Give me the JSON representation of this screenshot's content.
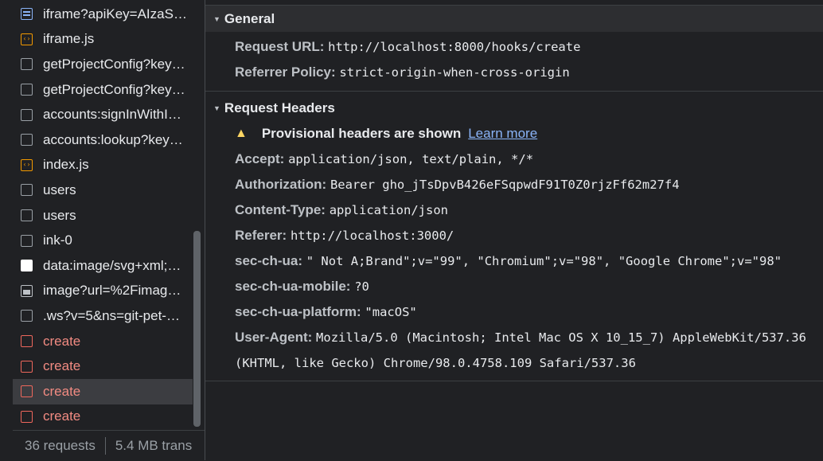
{
  "requests": [
    {
      "name": "iframe?apiKey=AIzaS…",
      "icon": "page",
      "status": "normal"
    },
    {
      "name": "iframe.js",
      "icon": "js",
      "status": "normal"
    },
    {
      "name": "getProjectConfig?key…",
      "icon": "doc",
      "status": "normal"
    },
    {
      "name": "getProjectConfig?key…",
      "icon": "doc",
      "status": "normal"
    },
    {
      "name": "accounts:signInWithI…",
      "icon": "doc",
      "status": "normal"
    },
    {
      "name": "accounts:lookup?key…",
      "icon": "doc",
      "status": "normal"
    },
    {
      "name": "index.js",
      "icon": "js",
      "status": "normal"
    },
    {
      "name": "users",
      "icon": "doc",
      "status": "normal"
    },
    {
      "name": "users",
      "icon": "doc",
      "status": "normal"
    },
    {
      "name": "ink-0",
      "icon": "doc",
      "status": "normal"
    },
    {
      "name": "data:image/svg+xml;…",
      "icon": "white",
      "status": "normal"
    },
    {
      "name": "image?url=%2Fimag…",
      "icon": "img",
      "status": "normal"
    },
    {
      "name": ".ws?v=5&ns=git-pet-…",
      "icon": "doc",
      "status": "normal"
    },
    {
      "name": "create",
      "icon": "err",
      "status": "error"
    },
    {
      "name": "create",
      "icon": "err",
      "status": "error"
    },
    {
      "name": "create",
      "icon": "err",
      "status": "error",
      "selected": true
    },
    {
      "name": "create",
      "icon": "err",
      "status": "error"
    }
  ],
  "footer": {
    "requests": "36 requests",
    "transferred": "5.4 MB trans"
  },
  "general": {
    "title": "General",
    "request_url_label": "Request URL:",
    "request_url": "http://localhost:8000/hooks/create",
    "referrer_policy_label": "Referrer Policy:",
    "referrer_policy": "strict-origin-when-cross-origin"
  },
  "request_headers": {
    "title": "Request Headers",
    "warning": "Provisional headers are shown",
    "learn_more": "Learn more",
    "headers": [
      {
        "name": "Accept:",
        "value": "application/json, text/plain, */*"
      },
      {
        "name": "Authorization:",
        "value": "Bearer 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"
      },
      {
        "name": "Content-Type:",
        "value": "application/json"
      },
      {
        "name": "Referer:",
        "value": "http://localhost:3000/"
      },
      {
        "name": "sec-ch-ua:",
        "value": "\" Not A;Brand\";v=\"99\", \"Chromium\";v=\"98\", \"Google Chrome\";v=\"98\""
      },
      {
        "name": "sec-ch-ua-mobile:",
        "value": "?0"
      },
      {
        "name": "sec-ch-ua-platform:",
        "value": "\"macOS\""
      },
      {
        "name": "User-Agent:",
        "value": "Mozilla/5.0 (Macintosh; Intel Mac OS X 10_15_7) AppleWebKit/537.36 (KHTML, like Gecko) Chrome/98.0.4758.109 Safari/537.36"
      }
    ]
  },
  "colors": {
    "error": "#f28b82",
    "link": "#8ab4f8",
    "warning": "#fdd663",
    "selected_row": "#3c3d41"
  }
}
